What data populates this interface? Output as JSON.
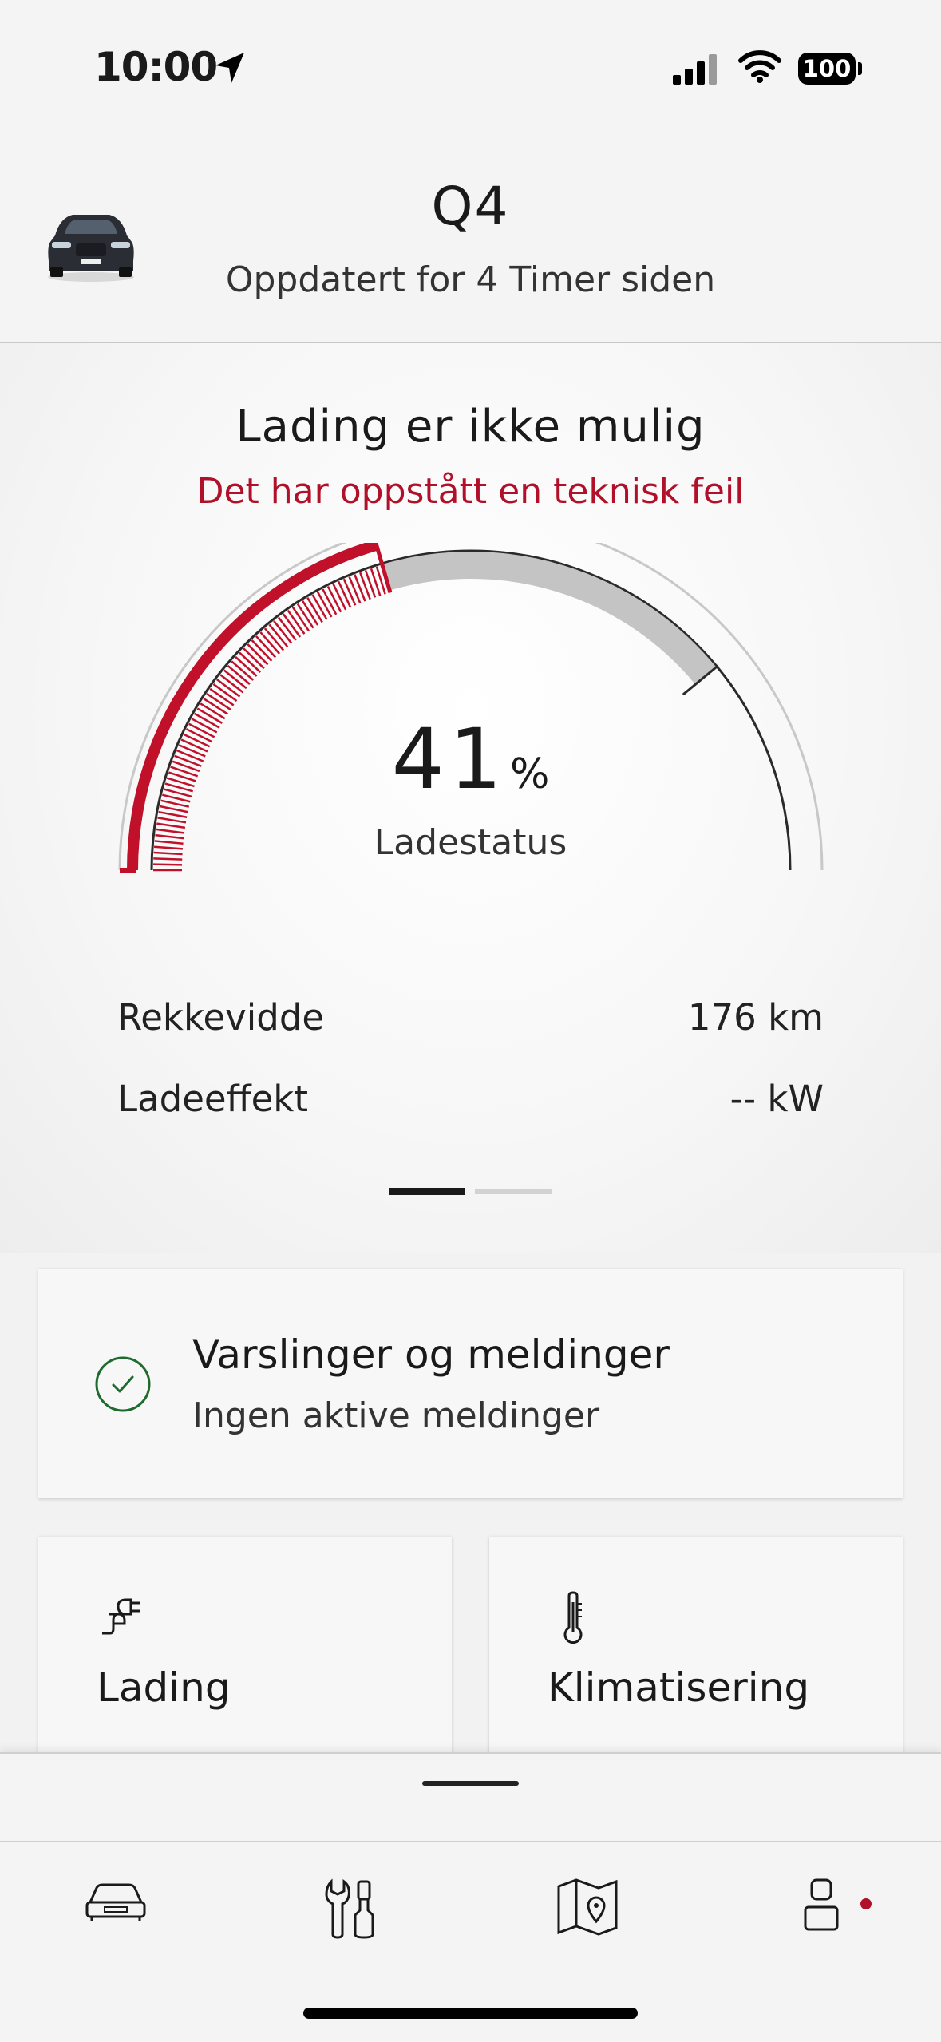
{
  "status_bar": {
    "time": "10:00",
    "battery": "100"
  },
  "header": {
    "car_name": "Q4",
    "updated": "Oppdatert for 4 Timer siden"
  },
  "charging": {
    "title": "Lading er ikke mulig",
    "error": "Det har oppstått en teknisk feil",
    "percent": "41",
    "percent_unit": "%",
    "percent_label": "Ladestatus",
    "state_of_charge_fraction": 0.41,
    "range_label": "Rekkevidde",
    "range_value": "176 km",
    "power_label": "Ladeeffekt",
    "power_value": "-- kW",
    "page_indicator": {
      "count": 2,
      "active": 0
    }
  },
  "notifications": {
    "title": "Varslinger og meldinger",
    "subtitle": "Ingen aktive meldinger"
  },
  "tiles": [
    {
      "label": "Lading",
      "icon": "plug-icon"
    },
    {
      "label": "Klimatisering",
      "icon": "thermometer-icon"
    }
  ],
  "tabbar": {
    "items": [
      {
        "name": "car-icon"
      },
      {
        "name": "tools-icon"
      },
      {
        "name": "map-icon"
      },
      {
        "name": "profile-icon"
      }
    ]
  },
  "colors": {
    "accent_red": "#b0102a",
    "success_green": "#1e6b2e",
    "text": "#1a1a1a"
  }
}
